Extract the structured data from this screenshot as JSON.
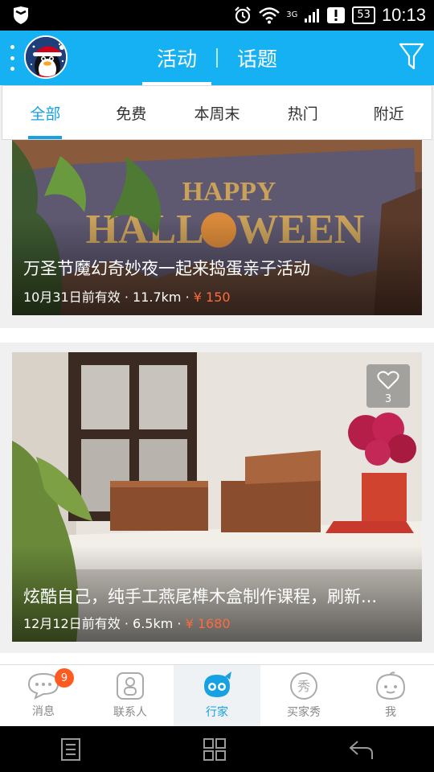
{
  "status_bar": {
    "time": "10:13",
    "battery": "53",
    "network": "3G",
    "icons": [
      "shield-icon",
      "alarm-icon",
      "wifi-icon",
      "signal-icon",
      "notification-icon",
      "battery-icon"
    ]
  },
  "header": {
    "tabs": [
      {
        "label": "活动",
        "active": true
      },
      {
        "label": "话题",
        "active": false
      }
    ],
    "accent_color": "#16b1f2"
  },
  "categories": [
    {
      "label": "全部",
      "active": true
    },
    {
      "label": "免费",
      "active": false
    },
    {
      "label": "本周末",
      "active": false
    },
    {
      "label": "热门",
      "active": false
    },
    {
      "label": "附近",
      "active": false
    }
  ],
  "cards": [
    {
      "title": "万圣节魔幻奇妙夜一起来捣蛋亲子活动",
      "expiry": "10月31日前有效",
      "distance": "11.7km",
      "price": "¥ 150",
      "banner_text": "HAPPY HALLOWEEN"
    },
    {
      "title": "炫酷自己，纯手工燕尾榫木盒制作课程，刷新...",
      "expiry": "12月12日前有效",
      "distance": "6.5km",
      "price": "¥ 1680",
      "likes": "3"
    }
  ],
  "separator": "·",
  "bottom_nav": [
    {
      "label": "消息",
      "icon": "message-icon",
      "badge": "9",
      "active": false
    },
    {
      "label": "联系人",
      "icon": "contacts-icon",
      "active": false
    },
    {
      "label": "行家",
      "icon": "expert-icon",
      "active": true
    },
    {
      "label": "买家秀",
      "icon": "show-icon",
      "active": false
    },
    {
      "label": "我",
      "icon": "profile-icon",
      "active": false
    }
  ],
  "price_color": "#ff6a3d"
}
